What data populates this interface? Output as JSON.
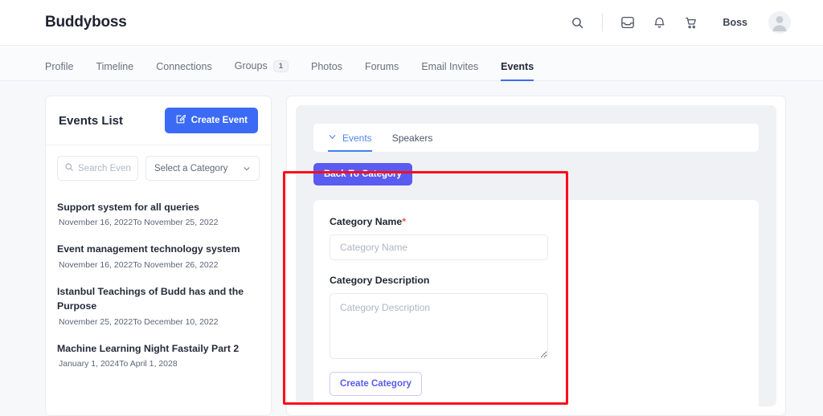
{
  "header": {
    "brand": "Buddyboss",
    "user_name": "Boss",
    "icons": {
      "search": "search-icon",
      "inbox": "inbox-icon",
      "notifications": "bell-icon",
      "cart": "cart-icon",
      "avatar": "avatar"
    }
  },
  "nav": {
    "items": [
      {
        "label": "Profile",
        "active": false
      },
      {
        "label": "Timeline",
        "active": false
      },
      {
        "label": "Connections",
        "active": false
      },
      {
        "label": "Groups",
        "active": false,
        "badge": "1"
      },
      {
        "label": "Photos",
        "active": false
      },
      {
        "label": "Forums",
        "active": false
      },
      {
        "label": "Email Invites",
        "active": false
      },
      {
        "label": "Events",
        "active": true
      }
    ]
  },
  "sidebar": {
    "title": "Events List",
    "create_event_label": "Create Event",
    "search_placeholder": "Search Events",
    "search_value": "",
    "category_select_label": "Select a Category",
    "events": [
      {
        "title": "Support system for all queries",
        "dates": "November 16, 2022To November 25, 2022"
      },
      {
        "title": "Event management technology system",
        "dates": "November 16, 2022To November 26, 2022"
      },
      {
        "title": "Istanbul Teachings of Budd has and the Purpose",
        "dates": "November 25, 2022To December 10, 2022"
      },
      {
        "title": "Machine Learning Night Fastaily Part 2",
        "dates": "January 1, 2024To April 1, 2028"
      }
    ]
  },
  "main": {
    "tabs": [
      {
        "label": "Events",
        "active": true
      },
      {
        "label": "Speakers",
        "active": false
      }
    ],
    "back_button_label": "Back To Category",
    "form": {
      "name_label": "Category Name",
      "name_required_mark": "*",
      "name_placeholder": "Category Name",
      "name_value": "",
      "description_label": "Category Description",
      "description_placeholder": "Category Description",
      "description_value": "",
      "submit_label": "Create Category"
    }
  },
  "annotation": {
    "color": "#fc0d1b",
    "shape": "rectangle-highlight"
  },
  "colors": {
    "page_background": "#f7f8fa",
    "primary_blue": "#3b6af5",
    "indigo": "#5a5bf0",
    "tab_blue": "#3e82ef",
    "required_red": "#f4573d",
    "annotation_red": "#fc0d1b"
  }
}
